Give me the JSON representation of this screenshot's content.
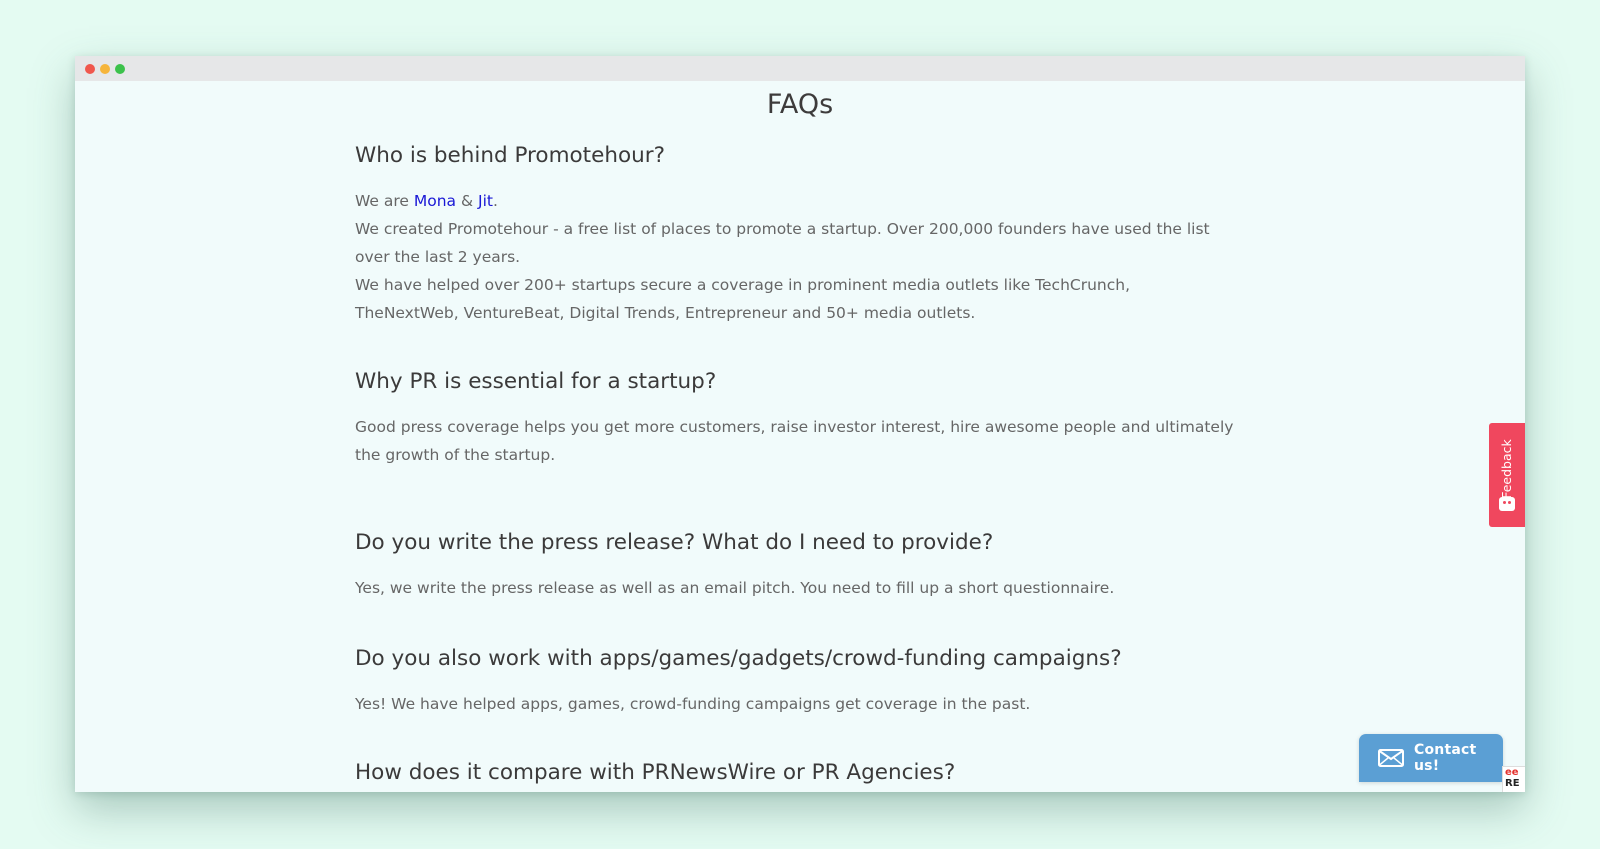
{
  "page": {
    "title": "FAQs"
  },
  "faqs": [
    {
      "question": "Who is behind Promotehour?",
      "answer_intro": "We are ",
      "link1": "Mona",
      "and": " & ",
      "link2": "Jit",
      "period": ".",
      "lines": [
        "We created Promotehour - a free list of places to promote a startup. Over 200,000 founders have used the list over the last 2 years.",
        "We have helped over 200+ startups secure a coverage in prominent media outlets like TechCrunch, TheNextWeb, VentureBeat, Digital Trends, Entrepreneur and 50+ media outlets."
      ]
    },
    {
      "question": "Why PR is essential for a startup?",
      "answer": "Good press coverage helps you get more customers, raise investor interest, hire awesome people and ultimately the growth of the startup."
    },
    {
      "question": "Do you write the press release? What do I need to provide?",
      "answer": "Yes, we write the press release as well as an email pitch. You need to fill up a short questionnaire."
    },
    {
      "question": "Do you also work with apps/games/gadgets/crowd-funding campaigns?",
      "answer": "Yes! We have helped apps, games, crowd-funding campaigns get coverage in the past."
    },
    {
      "question": "How does it compare with PRNewsWire or PR Agencies?"
    }
  ],
  "feedback": {
    "label": "Feedback",
    "icon": "smiley-icon"
  },
  "contact": {
    "label": "Contact us!",
    "icon": "mail-icon"
  },
  "badge": {
    "line1": "ee",
    "line2": "RE"
  },
  "colors": {
    "background": "#e4fbf2",
    "page": "#f1fbfb",
    "link": "#1a18d6",
    "feedback": "#f0475e",
    "contact": "#5b9fd4"
  }
}
